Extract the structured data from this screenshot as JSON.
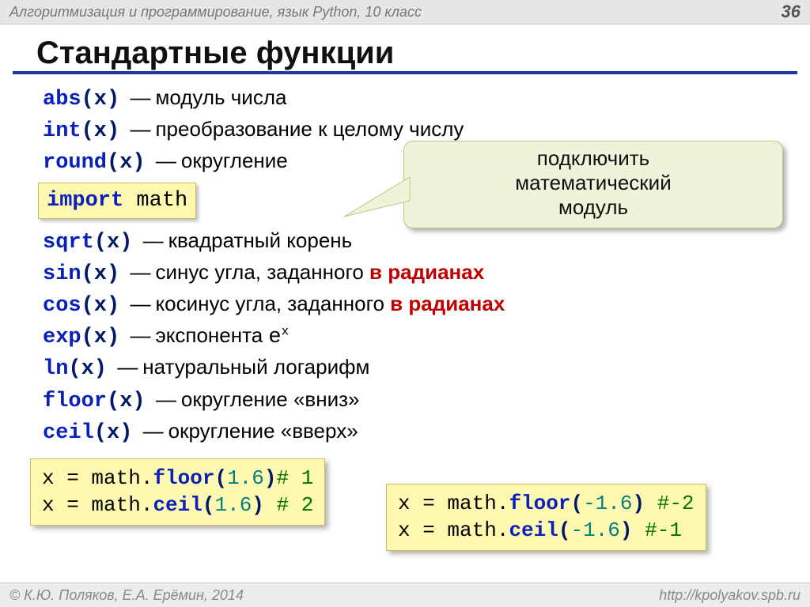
{
  "header": {
    "course": "Алгоритмизация и программирование, язык Python, 10 класс",
    "page": "36"
  },
  "title": "Стандартные функции",
  "funcs_top": [
    {
      "name": "abs",
      "arg": "(x)",
      "desc": "модуль числа"
    },
    {
      "name": "int",
      "arg": "(x)",
      "desc": "преобразование к целому числу"
    },
    {
      "name": "round",
      "arg": "(x)",
      "desc": "округление"
    }
  ],
  "import_stmt": {
    "kw": "import",
    "mod": "math"
  },
  "callout": {
    "line1": "подключить",
    "line2": "математический",
    "line3": "модуль"
  },
  "funcs_math": [
    {
      "name": "sqrt",
      "arg": "(x)",
      "pre": "квадратный корень",
      "red": ""
    },
    {
      "name": "sin",
      "arg": "(x)",
      "pre": "синус угла, заданного ",
      "red": "в радианах"
    },
    {
      "name": "cos",
      "arg": "(x)",
      "pre": "косинус угла, заданного ",
      "red": "в радианах"
    },
    {
      "name": "exp",
      "arg": "(x)",
      "pre": "экспонента ",
      "expo": "e",
      "sup": "x"
    },
    {
      "name": "ln",
      "arg": "(x)",
      "pre": "натуральный логарифм",
      "red": ""
    },
    {
      "name": "floor",
      "arg": "(x)",
      "pre": "округление «вниз»",
      "red": ""
    },
    {
      "name": "ceil",
      "arg": "(x)",
      "pre": "округление «вверх»",
      "red": ""
    }
  ],
  "ex_left": {
    "l1": {
      "lhs": "x = ",
      "obj": "math",
      "dot": ".",
      "fn": "floor",
      "op": "(",
      "num": "1.6",
      "cp": ")",
      "cmt": "# 1"
    },
    "l2": {
      "lhs": "x = ",
      "obj": "math",
      "dot": ".",
      "fn": "ceil",
      "op": "(",
      "num": "1.6",
      "cp": ") ",
      "cmt": "# 2"
    }
  },
  "ex_right": {
    "l1": {
      "lhs": "x = ",
      "obj": "math",
      "dot": ".",
      "fn": "floor",
      "op": "(",
      "num": "-1.6",
      "cp": ") ",
      "cmt": "#-2"
    },
    "l2": {
      "lhs": "x = ",
      "obj": "math",
      "dot": ".",
      "fn": "ceil",
      "op": "(",
      "num": "-1.6",
      "cp": ")  ",
      "cmt": "#-1"
    }
  },
  "footer": {
    "left": "© К.Ю. Поляков, Е.А. Ерёмин, 2014",
    "right": "http://kpolyakov.spb.ru"
  }
}
